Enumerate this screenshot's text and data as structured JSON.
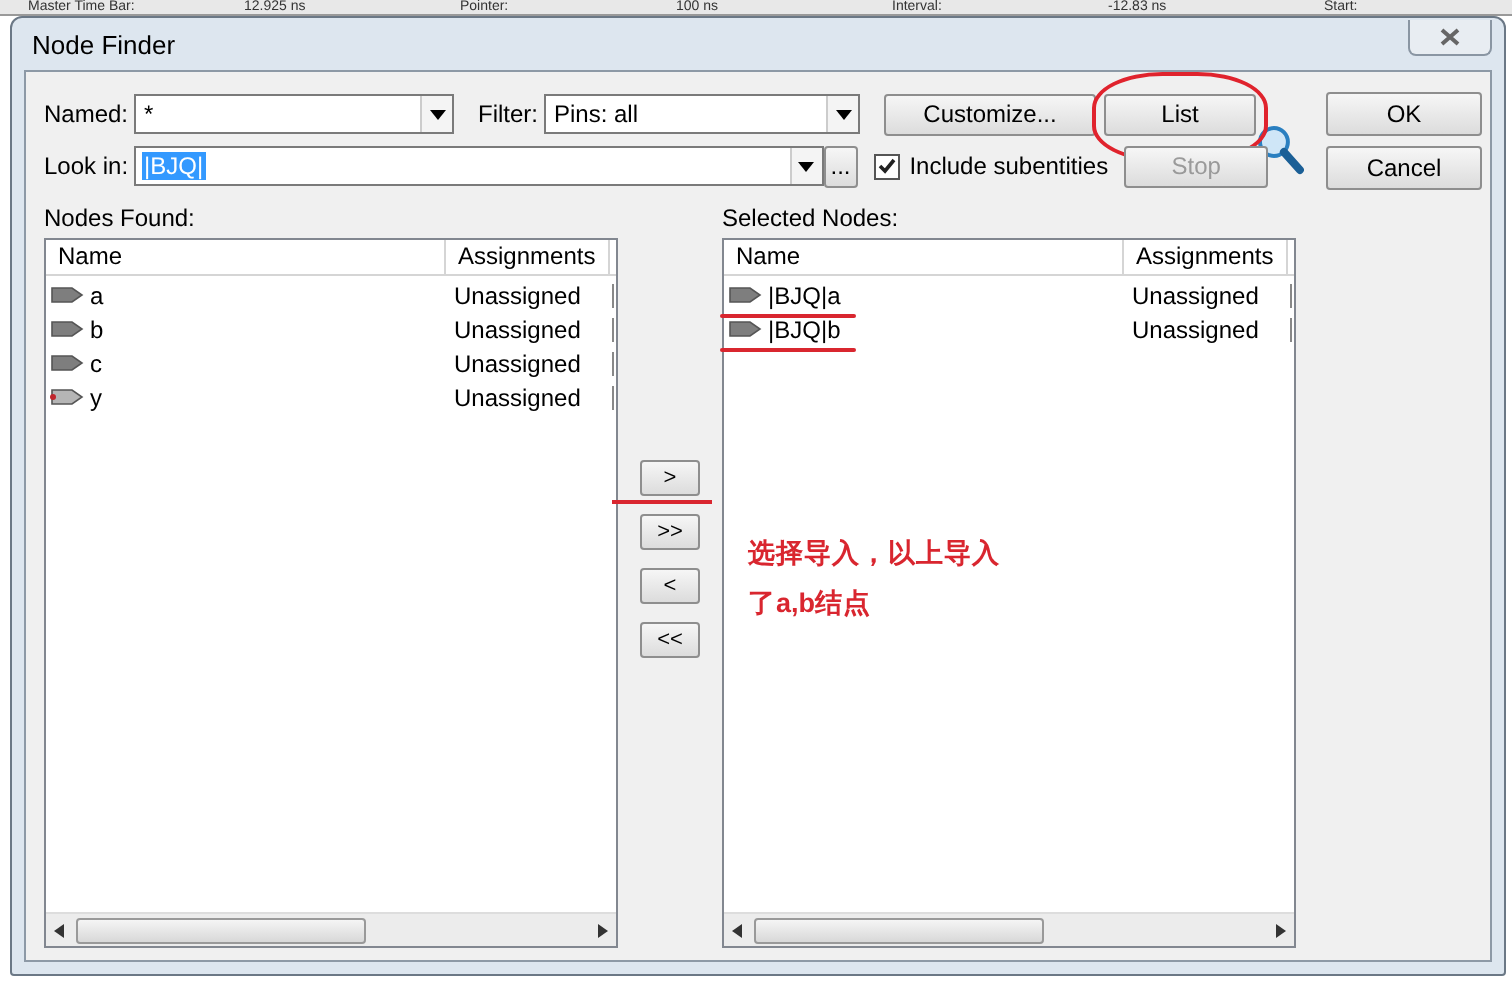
{
  "background_bar": {
    "items": [
      "Master Time Bar:",
      "12.925 ns",
      "Pointer:",
      "100 ns",
      "Interval:",
      "-12.83 ns",
      "Start:"
    ]
  },
  "window": {
    "title": "Node Finder"
  },
  "named": {
    "label": "Named:",
    "value": "*"
  },
  "filter": {
    "label": "Filter:",
    "value": "Pins: all"
  },
  "look_in": {
    "label": "Look in:",
    "value": "|BJQ|",
    "browse": "..."
  },
  "include_subentities": {
    "label": "Include subentities",
    "checked": true
  },
  "buttons": [
    {
      "label": "Customize...",
      "disabled": false,
      "circled": false
    },
    {
      "label": "List",
      "disabled": false,
      "circled": true
    },
    {
      "label": "Stop",
      "disabled": true,
      "circled": false
    }
  ],
  "dialog_buttons": [
    "OK",
    "Cancel"
  ],
  "nodes_found": {
    "label": "Nodes Found:",
    "columns": [
      "Name",
      "Assignments"
    ],
    "rows": [
      {
        "name": "a",
        "assignments": "Unassigned",
        "kind": "input"
      },
      {
        "name": "b",
        "assignments": "Unassigned",
        "kind": "input"
      },
      {
        "name": "c",
        "assignments": "Unassigned",
        "kind": "input"
      },
      {
        "name": "y",
        "assignments": "Unassigned",
        "kind": "output"
      }
    ]
  },
  "transfer_buttons": [
    {
      "label": ">",
      "underlined": true
    },
    {
      "label": ">>",
      "underlined": false
    },
    {
      "label": "<",
      "underlined": false
    },
    {
      "label": "<<",
      "underlined": false
    }
  ],
  "selected_nodes": {
    "label": "Selected Nodes:",
    "columns": [
      "Name",
      "Assignments"
    ],
    "rows": [
      {
        "name": "|BJQ|a",
        "assignments": "Unassigned",
        "kind": "input",
        "underlined": true
      },
      {
        "name": "|BJQ|b",
        "assignments": "Unassigned",
        "kind": "input",
        "underlined": true
      }
    ]
  },
  "annotation": {
    "text": "选择导入，以上导入了a,b结点"
  }
}
